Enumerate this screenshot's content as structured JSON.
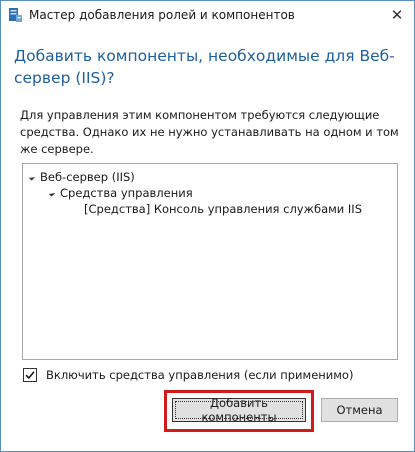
{
  "window": {
    "title": "Мастер добавления ролей и компонентов",
    "app_icon": "server-manager-icon",
    "close_glyph": "✕"
  },
  "header": {
    "title": "Добавить компоненты, необходимые для Веб-сервер (IIS)?"
  },
  "description": "Для управления этим компонентом требуются следующие средства. Однако их не нужно устанавливать на одном и том же сервере.",
  "tree": {
    "items": [
      {
        "label": "Веб-сервер (IIS)",
        "expanded": true,
        "level": 0
      },
      {
        "label": "Средства управления",
        "expanded": true,
        "level": 1
      },
      {
        "label": "[Средства] Консоль управления службами IIS",
        "expanded": false,
        "level": 2
      }
    ]
  },
  "include_tools": {
    "label": "Включить средства управления (если применимо)",
    "checked": true
  },
  "buttons": {
    "add_label": "Добавить компоненты",
    "cancel_label": "Отмена"
  },
  "colors": {
    "header_text": "#1e5f9e",
    "highlight": "#d11a1a",
    "window_border": "#5a8fc4"
  }
}
